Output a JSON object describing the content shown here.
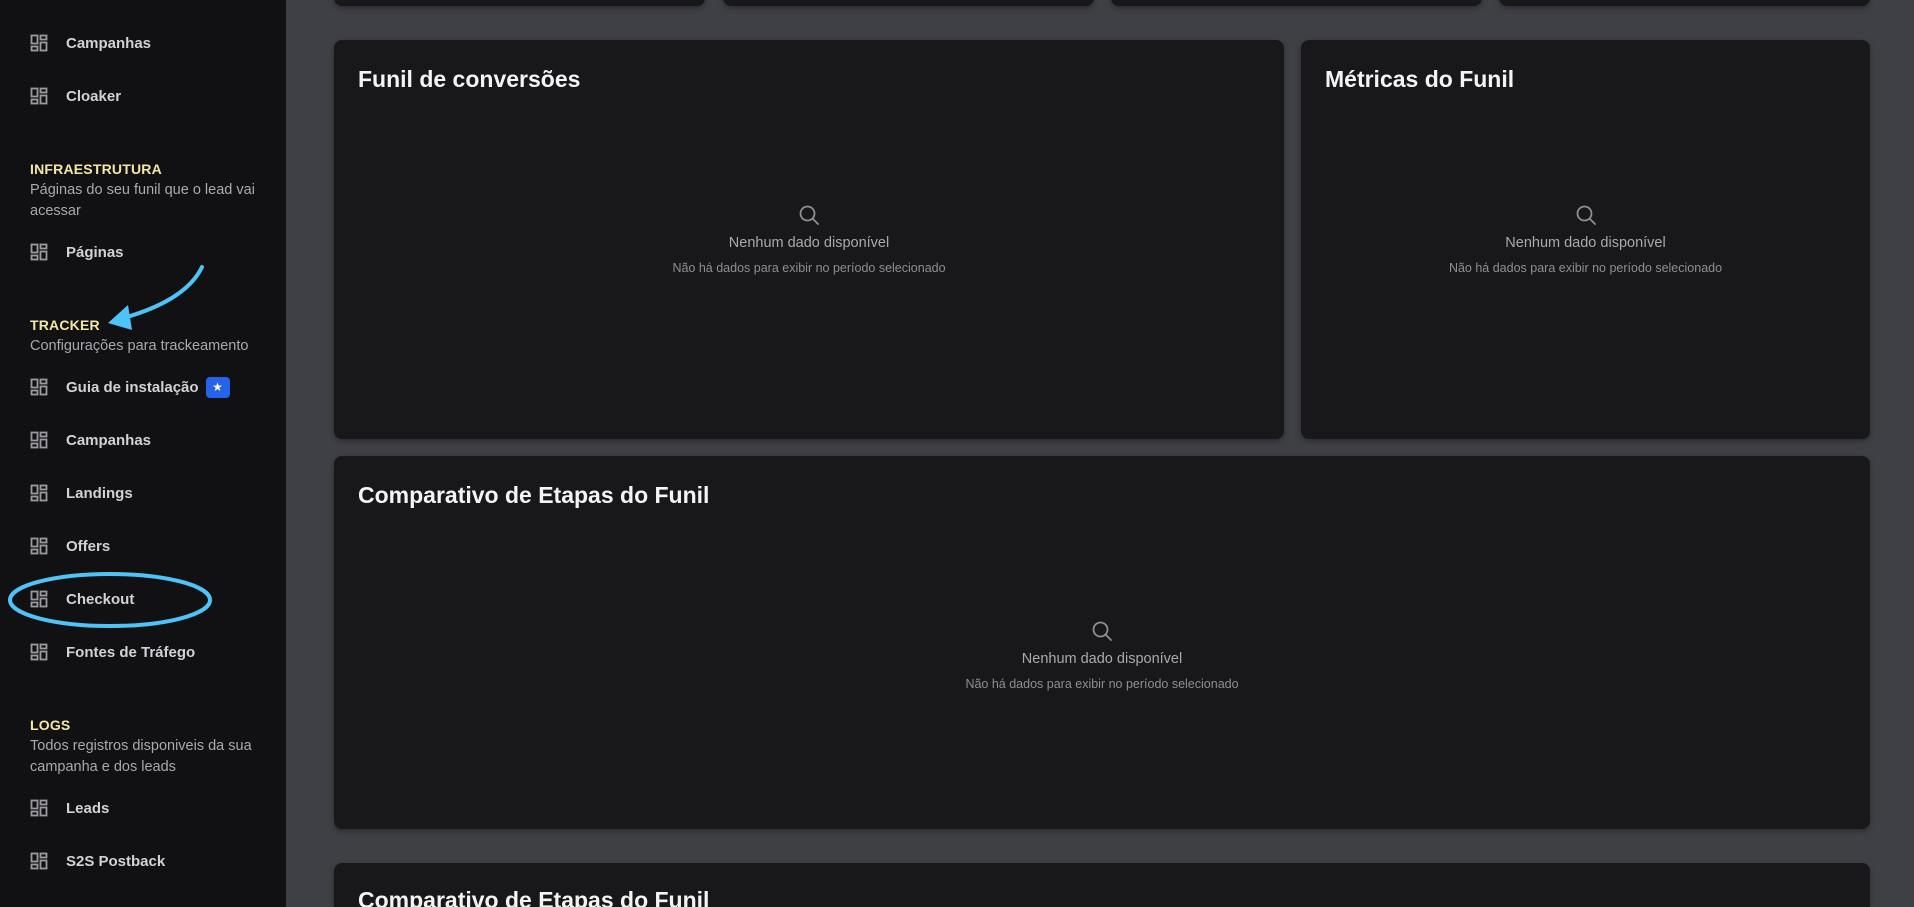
{
  "sidebar": {
    "items_top": [
      {
        "label": "Campanhas",
        "icon": "dashboard-icon"
      },
      {
        "label": "Cloaker",
        "icon": "dashboard-icon"
      }
    ],
    "sections": [
      {
        "title": "INFRAESTRUTURA",
        "description": "Páginas do seu funil que o lead vai acessar",
        "items": [
          {
            "label": "Páginas",
            "icon": "dashboard-icon"
          }
        ]
      },
      {
        "title": "TRACKER",
        "description": "Configurações para trackeamento",
        "items": [
          {
            "label": "Guia de instalação",
            "icon": "dashboard-icon",
            "badge": "★"
          },
          {
            "label": "Campanhas",
            "icon": "dashboard-icon"
          },
          {
            "label": "Landings",
            "icon": "dashboard-icon"
          },
          {
            "label": "Offers",
            "icon": "dashboard-icon"
          },
          {
            "label": "Checkout",
            "icon": "dashboard-icon"
          },
          {
            "label": "Fontes de Tráfego",
            "icon": "dashboard-icon"
          }
        ]
      },
      {
        "title": "LOGS",
        "description": "Todos registros disponiveis da sua campanha e dos leads",
        "items": [
          {
            "label": "Leads",
            "icon": "dashboard-icon"
          },
          {
            "label": "S2S Postback",
            "icon": "dashboard-icon"
          }
        ]
      }
    ]
  },
  "main": {
    "cards": [
      {
        "title": "Funil de conversões",
        "empty_title": "Nenhum dado disponível",
        "empty_sub": "Não há dados para exibir no período selecionado"
      },
      {
        "title": "Métricas do Funil",
        "empty_title": "Nenhum dado disponível",
        "empty_sub": "Não há dados para exibir no período selecionado"
      },
      {
        "title": "Comparativo de Etapas do Funil",
        "empty_title": "Nenhum dado disponível",
        "empty_sub": "Não há dados para exibir no período selecionado"
      },
      {
        "title": "Comparativo de Etapas do Funil"
      }
    ]
  },
  "annotations": {
    "arrow_color": "#4fc3f7",
    "circle_color": "#4fc3f7"
  },
  "colors": {
    "sidebar_bg": "#111113",
    "main_bg": "#3f4045",
    "card_bg": "#18181b",
    "section_title": "#f4e7a6",
    "badge": "#2563eb"
  }
}
